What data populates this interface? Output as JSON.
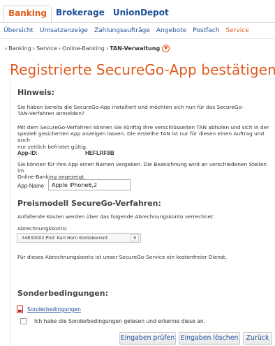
{
  "top_tabs": [
    "Banking",
    "Brokerage",
    "UnionDepot"
  ],
  "sub_nav": [
    "Übersicht",
    "Umsatzanzeige",
    "Zahlungsaufträge",
    "Angebote",
    "Postfach",
    "Service"
  ],
  "breadcrumb": {
    "items": [
      "Banking",
      "Service",
      "Online-Banking"
    ],
    "current": "TAN-Verwaltung",
    "icon": "chevron-down-icon"
  },
  "page_title": "Registrierte SecureGo-App bestätigen",
  "hinweis": {
    "heading": "Hinweis:",
    "p1_line1": "Sie haben bereits die SecureGo-App installiert und möchten sich nun für das SecureGo-",
    "p1_line2": "TAN-Verfahren anmelden?",
    "p2_line1": "Mit dem SecureGo-Verfahren können Sie künftig Ihre verschlüsselten TAN abholen und sich in der",
    "p2_line2": "speziell gesicherten App anzeigen lassen. Die erstellte TAN ist nur für diesen einen Auftrag und auch",
    "p2_line3": "nur zeitlich befristet gültig.",
    "app_id_label": "App-ID:",
    "app_id_value": "HEFLRF8B",
    "p3_line1": "Sie können für Ihre App einen Namen vergeben. Die Bezeichnung wird an verschiedenen Stellen im",
    "p3_line2": "Online-Banking angezeigt.",
    "app_name_label": "App-Name",
    "app_name_value": "Apple iPhone6,2"
  },
  "preismodell": {
    "heading": "Preismodell SecureGo-Verfahren:",
    "intro": "Anfallende Kosten werden über das folgende Abrechnungskonto verrechnet:",
    "account_label": "Abrechnungskonto:",
    "account_selected": "34830002  Prof. Karl Horn  Kontokorrent",
    "info": "Für dieses Abrechnungskonto ist unser SecureGo-Service ein kostenfreier Dienst."
  },
  "sonder": {
    "heading": "Sonderbedingungen:",
    "link": "Sonderbedingungen",
    "checkbox_label": "Ich habe die Sonderbedingungen gelesen und erkenne diese an."
  },
  "buttons": {
    "check": "Eingaben prüfen",
    "clear": "Eingaben löschen",
    "back": "Zurück"
  },
  "colors": {
    "accent": "#e05a1e",
    "link": "#1f4f9a",
    "text": "#333333"
  }
}
